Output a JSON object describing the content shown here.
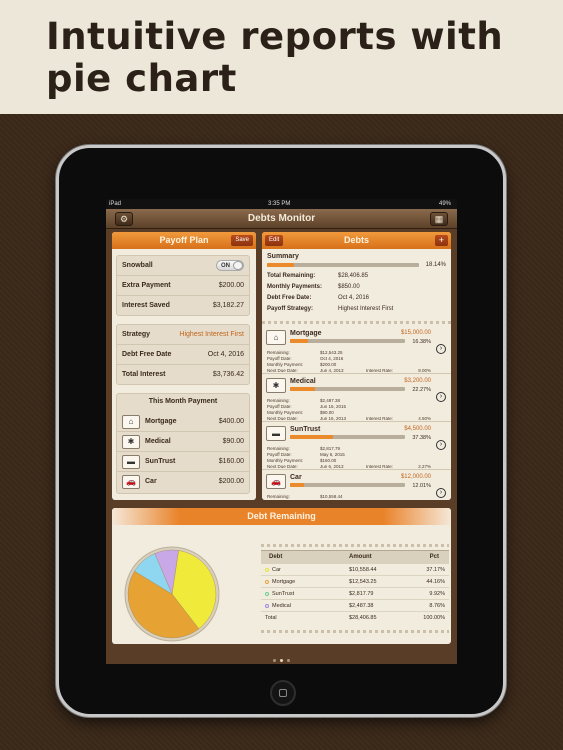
{
  "banner": {
    "title": "Intuitive reports with pie chart"
  },
  "status": {
    "carrier": "iPad",
    "time": "3:35 PM",
    "battery": "49%"
  },
  "nav": {
    "title": "Debts Monitor",
    "settings_icon": "gear-icon",
    "report_icon": "calculator-icon"
  },
  "payoff": {
    "title": "Payoff Plan",
    "save_label": "Save",
    "snowball_label": "Snowball",
    "snowball_toggle": "ON",
    "extra_payment_label": "Extra Payment",
    "extra_payment_value": "$200.00",
    "interest_saved_label": "Interest Saved",
    "interest_saved_value": "$3,182.27",
    "strategy_label": "Strategy",
    "strategy_value": "Highest Interest First",
    "debt_free_label": "Debt Free Date",
    "debt_free_value": "Oct 4, 2016",
    "total_interest_label": "Total Interest",
    "total_interest_value": "$3,736.42",
    "month_title": "This Month Payment",
    "month_payments": [
      {
        "name": "Mortgage",
        "amount": "$400.00",
        "icon": "house-icon"
      },
      {
        "name": "Medical",
        "amount": "$90.00",
        "icon": "medical-icon"
      },
      {
        "name": "SunTrust",
        "amount": "$160.00",
        "icon": "credit-card-icon"
      },
      {
        "name": "Car",
        "amount": "$200.00",
        "icon": "car-icon"
      }
    ]
  },
  "debts": {
    "title": "Debts",
    "edit_label": "Edit",
    "add_label": "+",
    "summary_title": "Summary",
    "summary_pct": "18.14%",
    "summary_progress": 0.18,
    "summary_lines": [
      {
        "key": "Total Remaining:",
        "value": "$28,406.85"
      },
      {
        "key": "Monthly Payments:",
        "value": "$850.00"
      },
      {
        "key": "Debt Free Date:",
        "value": "Oct 4, 2016"
      },
      {
        "key": "Payoff Strategy:",
        "value": "Highest Interest First"
      }
    ],
    "detail_labels": {
      "remaining": "Remaining:",
      "payoff_date": "Payoff Date:",
      "monthly_payment": "Monthly Payment:",
      "next_due": "Next Due Date:",
      "interest_rate": "Interest Rate:"
    },
    "items": [
      {
        "name": "Mortgage",
        "amount": "$15,000.00",
        "pct": "16.38%",
        "progress": 0.16,
        "icon": "house-icon",
        "remaining": "$12,543.25",
        "payoff_date": "Oct 4, 2016",
        "monthly_payment": "$200.00",
        "next_due": "Jun 4, 2013",
        "interest_rate": "8.00%"
      },
      {
        "name": "Medical",
        "amount": "$3,200.00",
        "pct": "22.27%",
        "progress": 0.22,
        "icon": "medical-icon",
        "remaining": "$2,487.38",
        "payoff_date": "Jun 16, 2015",
        "monthly_payment": "$90.00",
        "next_due": "Jun 16, 2013",
        "interest_rate": "4.50%"
      },
      {
        "name": "SunTrust",
        "amount": "$4,500.00",
        "pct": "37.38%",
        "progress": 0.37,
        "icon": "credit-card-icon",
        "remaining": "$2,817.79",
        "payoff_date": "May 6, 2015",
        "monthly_payment": "$160.00",
        "next_due": "Jun 6, 2013",
        "interest_rate": "2.27%"
      },
      {
        "name": "Car",
        "amount": "$12,000.00",
        "pct": "12.01%",
        "progress": 0.12,
        "icon": "car-icon",
        "remaining": "$10,558.44",
        "payoff_date": "",
        "monthly_payment": "",
        "next_due": "",
        "interest_rate": ""
      }
    ]
  },
  "report": {
    "title": "Debt Remaining",
    "col_debt": "Debt",
    "col_amount": "Amount",
    "col_pct": "Pct",
    "rows": [
      {
        "name": "Car",
        "amount": "$10,558.44",
        "pct": "37.17%",
        "color": "#e8e43a"
      },
      {
        "name": "Mortgage",
        "amount": "$12,543.25",
        "pct": "44.16%",
        "color": "#e8a23a"
      },
      {
        "name": "SunTrust",
        "amount": "$2,817.79",
        "pct": "9.92%",
        "color": "#6ad08a"
      },
      {
        "name": "Medical",
        "amount": "$2,487.38",
        "pct": "8.76%",
        "color": "#9a8ae0"
      }
    ],
    "total_label": "Total",
    "total_amount": "$28,406.85",
    "total_pct": "100.00%"
  },
  "chart_data": {
    "type": "pie",
    "categories": [
      "Car",
      "Mortgage",
      "SunTrust",
      "Medical"
    ],
    "values": [
      37.17,
      44.16,
      9.92,
      8.76
    ],
    "colors": [
      "#f0ea3a",
      "#e6a232",
      "#8fd6f0",
      "#c9a8e8"
    ]
  },
  "pager": {
    "pages": 3,
    "current": 1
  }
}
